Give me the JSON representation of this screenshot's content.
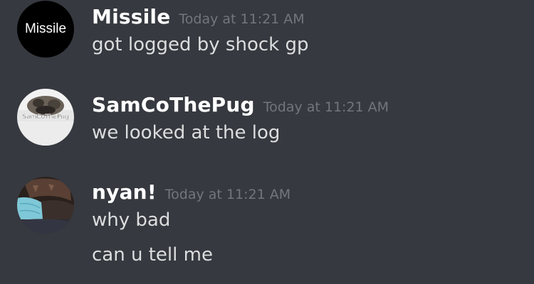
{
  "messages": [
    {
      "username": "Missile",
      "timestamp": "Today at 11:21 AM",
      "avatar_text": "Missile",
      "lines": [
        "got logged by shock gp"
      ]
    },
    {
      "username": "SamCoThePug",
      "timestamp": "Today at 11:21 AM",
      "avatar_text": "SamCoThePug",
      "lines": [
        "we looked at the log"
      ]
    },
    {
      "username": "nyan!",
      "timestamp": "Today at 11:21 AM",
      "lines": [
        "why bad",
        "can u tell me"
      ]
    }
  ],
  "colors": {
    "background": "#36393f",
    "username": "#ffffff",
    "timestamp": "#72767d",
    "message_text": "#dcddde"
  }
}
